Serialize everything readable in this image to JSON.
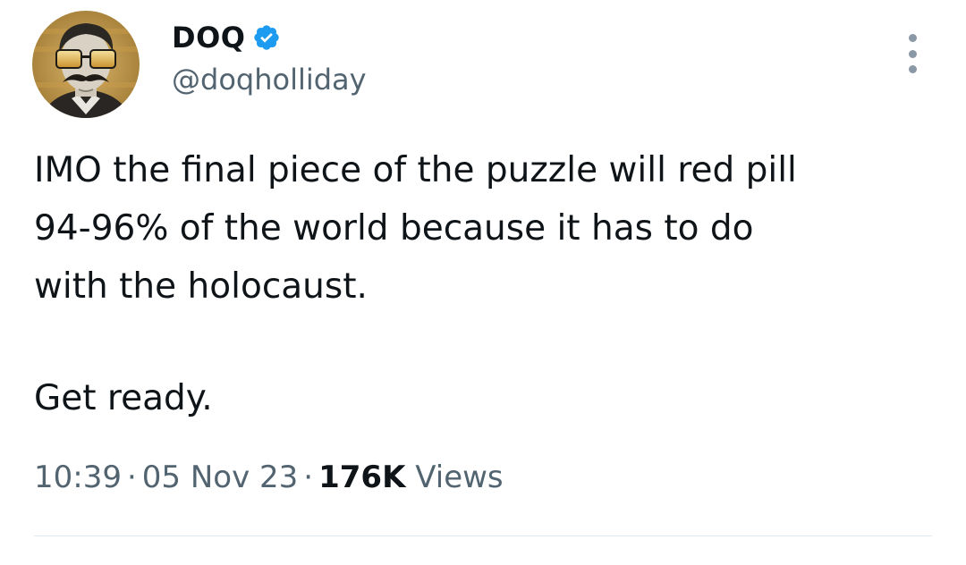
{
  "user": {
    "display_name": "DOQ",
    "handle": "@doqholliday",
    "verified": true,
    "avatar_icon": "avatar-mustache-sunglasses"
  },
  "tweet": {
    "lines": [
      "IMO the final piece of the puzzle will red pill",
      "94-96% of the world because it has to do",
      "with the holocaust.",
      "Get ready."
    ]
  },
  "meta": {
    "time": "10:39",
    "date": "05 Nov 23",
    "separator": "·",
    "views_count": "176K",
    "views_label": "Views"
  },
  "icons": {
    "verified": "verified-badge-icon",
    "more": "more-options-icon"
  },
  "colors": {
    "verified_blue": "#1d9bf0",
    "secondary_text": "#536471",
    "primary_text": "#0f1419"
  }
}
